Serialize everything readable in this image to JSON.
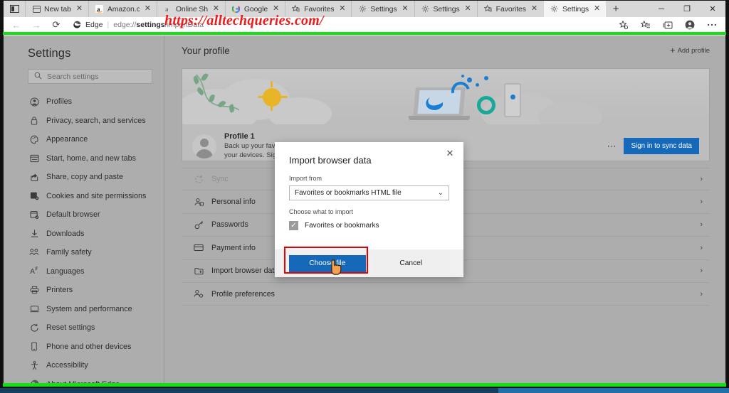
{
  "browser": {
    "tab_list_icon": "tab-list-icon",
    "tabs": [
      {
        "title": "New tab",
        "favicon": "newtab-icon",
        "active": false
      },
      {
        "title": "Amazon.com.",
        "favicon": "amazon-icon",
        "active": false
      },
      {
        "title": "Online Shopp",
        "favicon": "amazon-icon",
        "active": false
      },
      {
        "title": "Google",
        "favicon": "google-icon",
        "active": false
      },
      {
        "title": "Favorites",
        "favicon": "favorites-star-icon",
        "active": false
      },
      {
        "title": "Settings",
        "favicon": "gear-icon",
        "active": false
      },
      {
        "title": "Settings",
        "favicon": "gear-icon",
        "active": false
      },
      {
        "title": "Favorites",
        "favicon": "favorites-star-icon",
        "active": false
      },
      {
        "title": "Settings",
        "favicon": "gear-icon",
        "active": true
      }
    ],
    "new_tab_label": "+",
    "window_controls": {
      "minimize": "─",
      "maximize": "❐",
      "close": "✕"
    },
    "nav": {
      "back": "←",
      "forward": "→",
      "reload": "⟳"
    },
    "address": {
      "brand": "Edge",
      "separator": "|",
      "url_prefix": "edge://",
      "url_bold": "settings",
      "url_suffix": "/importData"
    },
    "toolbar_icons": [
      "add-favorite-icon",
      "favorites-hub-icon",
      "collections-icon",
      "profile-avatar-icon",
      "settings-and-more-icon"
    ]
  },
  "sidebar": {
    "title": "Settings",
    "search_placeholder": "Search settings",
    "search_icon": "search-icon",
    "items": [
      {
        "label": "Profiles",
        "icon": "profile-icon"
      },
      {
        "label": "Privacy, search, and services",
        "icon": "lock-icon"
      },
      {
        "label": "Appearance",
        "icon": "palette-icon"
      },
      {
        "label": "Start, home, and new tabs",
        "icon": "window-icon"
      },
      {
        "label": "Share, copy and paste",
        "icon": "share-icon"
      },
      {
        "label": "Cookies and site permissions",
        "icon": "cookie-icon"
      },
      {
        "label": "Default browser",
        "icon": "default-browser-icon"
      },
      {
        "label": "Downloads",
        "icon": "download-icon"
      },
      {
        "label": "Family safety",
        "icon": "family-icon"
      },
      {
        "label": "Languages",
        "icon": "language-icon"
      },
      {
        "label": "Printers",
        "icon": "printer-icon"
      },
      {
        "label": "System and performance",
        "icon": "laptop-icon"
      },
      {
        "label": "Reset settings",
        "icon": "reset-icon"
      },
      {
        "label": "Phone and other devices",
        "icon": "phone-icon"
      },
      {
        "label": "Accessibility",
        "icon": "accessibility-icon"
      },
      {
        "label": "About Microsoft Edge",
        "icon": "edge-logo-icon"
      }
    ]
  },
  "main": {
    "page_title": "Your profile",
    "add_profile_label": "Add profile",
    "add_profile_icon": "plus-icon",
    "watermark": "https://alltechqueries.com/",
    "watermark_color": "#f01b1b",
    "profile": {
      "name": "Profile 1",
      "description_line1": "Back up your favorites, passwords, and more across",
      "description_line2": "your devices. Sign in to sync.",
      "avatar_icon": "avatar-icon",
      "more_icon": "more-options-icon",
      "sign_in_label": "Sign in to sync data"
    },
    "rows": [
      {
        "label": "Sync",
        "icon": "sync-icon",
        "dim": true,
        "chevron": "›"
      },
      {
        "label": "Personal info",
        "icon": "personal-info-icon",
        "dim": false,
        "chevron": "›"
      },
      {
        "label": "Passwords",
        "icon": "key-icon",
        "dim": false,
        "chevron": "›"
      },
      {
        "label": "Payment info",
        "icon": "credit-card-icon",
        "dim": false,
        "chevron": "›"
      },
      {
        "label": "Import browser data",
        "icon": "import-icon",
        "dim": false,
        "chevron": "›"
      },
      {
        "label": "Profile preferences",
        "icon": "profile-preferences-icon",
        "dim": false,
        "chevron": "›"
      }
    ]
  },
  "dialog": {
    "title": "Import browser data",
    "close_icon": "close-icon",
    "import_from_label": "Import from",
    "import_from_value": "Favorites or bookmarks HTML file",
    "dropdown_icon": "chevron-down-icon",
    "choose_what_label": "Choose what to import",
    "checkbox_label": "Favorites or bookmarks",
    "checkbox_checked": true,
    "checkbox_mark": "✓",
    "primary_button": "Choose file",
    "secondary_button": "Cancel",
    "highlight_color": "#e60000",
    "primary_color": "#1668b8"
  }
}
